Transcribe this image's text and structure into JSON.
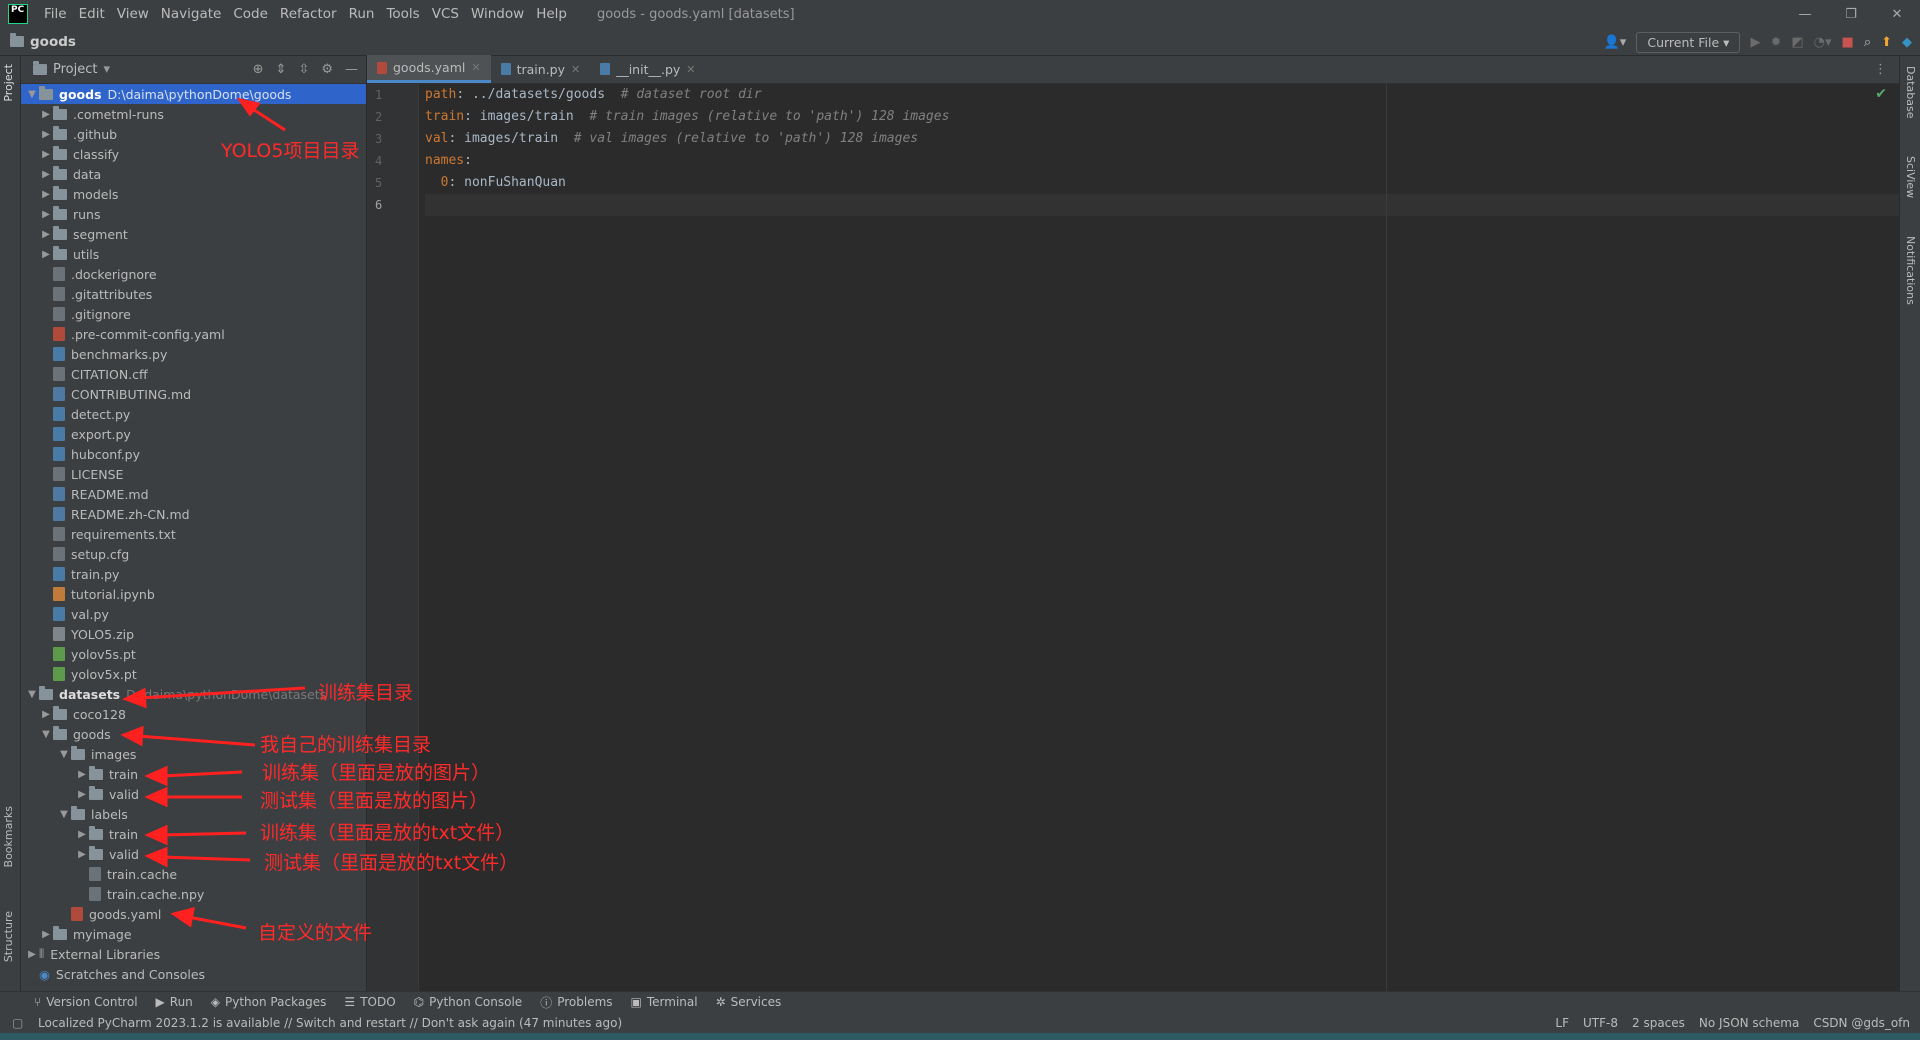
{
  "titlebar": {
    "menu": [
      "File",
      "Edit",
      "View",
      "Navigate",
      "Code",
      "Refactor",
      "Run",
      "Tools",
      "VCS",
      "Window",
      "Help"
    ],
    "title": "goods - goods.yaml [datasets]"
  },
  "navbar": {
    "crumb": "goods",
    "run_config": "Current File"
  },
  "left_strip": {
    "project": "Project",
    "bookmarks": "Bookmarks",
    "structure": "Structure"
  },
  "right_strip": {
    "database": "Database",
    "sciview": "SciView",
    "notifications": "Notifications"
  },
  "project_panel": {
    "title": "Project",
    "root": {
      "name": "goods",
      "path": "D:\\daima\\pythonDome\\goods"
    },
    "items": [
      {
        "label": ".cometml-runs"
      },
      {
        "label": ".github"
      },
      {
        "label": "classify"
      },
      {
        "label": "data"
      },
      {
        "label": "models"
      },
      {
        "label": "runs"
      },
      {
        "label": "segment"
      },
      {
        "label": "utils"
      },
      {
        "label": ".dockerignore"
      },
      {
        "label": ".gitattributes"
      },
      {
        "label": ".gitignore"
      },
      {
        "label": ".pre-commit-config.yaml"
      },
      {
        "label": "benchmarks.py"
      },
      {
        "label": "CITATION.cff"
      },
      {
        "label": "CONTRIBUTING.md"
      },
      {
        "label": "detect.py"
      },
      {
        "label": "export.py"
      },
      {
        "label": "hubconf.py"
      },
      {
        "label": "LICENSE"
      },
      {
        "label": "README.md"
      },
      {
        "label": "README.zh-CN.md"
      },
      {
        "label": "requirements.txt"
      },
      {
        "label": "setup.cfg"
      },
      {
        "label": "train.py"
      },
      {
        "label": "tutorial.ipynb"
      },
      {
        "label": "val.py"
      },
      {
        "label": "YOLO5.zip"
      },
      {
        "label": "yolov5s.pt"
      },
      {
        "label": "yolov5x.pt"
      }
    ],
    "datasets": {
      "name": "datasets",
      "path": "D:\\daima\\pythonDome\\datasets"
    },
    "ds_items": [
      "coco128",
      "goods",
      "images",
      "train",
      "valid",
      "labels",
      "train",
      "valid",
      "train.cache",
      "train.cache.npy",
      "goods.yaml",
      "myimage"
    ],
    "external": "External Libraries",
    "scratches": "Scratches and Consoles"
  },
  "editor": {
    "tabs": [
      "goods.yaml",
      "train.py",
      "__init__.py"
    ],
    "line_numbers": [
      "1",
      "2",
      "3",
      "4",
      "5",
      "6"
    ],
    "lines": [
      {
        "key": "path",
        "val": ": ../datasets/goods  ",
        "comment": "# dataset root dir"
      },
      {
        "key": "train",
        "val": ": images/train  ",
        "comment": "# train images (relative to 'path') 128 images"
      },
      {
        "key": "val",
        "val": ": images/train  ",
        "comment": "# val images (relative to 'path') 128 images"
      },
      {
        "key": "names",
        "val": ":",
        "comment": ""
      },
      {
        "key": "  0",
        "val": ": nonFuShanQuan",
        "comment": ""
      }
    ]
  },
  "annotations": {
    "yolo": "YOLO5项目目录",
    "train_dir": "训练集目录",
    "my_train_dir": "我自己的训练集目录",
    "img_train": "训练集（里面是放的图片）",
    "img_valid": "测试集（里面是放的图片）",
    "lbl_train": "训练集（里面是放的txt文件）",
    "lbl_valid": "测试集（里面是放的txt文件）",
    "custom_file": "自定义的文件"
  },
  "toolwindows": [
    "Version Control",
    "Run",
    "Python Packages",
    "TODO",
    "Python Console",
    "Problems",
    "Terminal",
    "Services"
  ],
  "status": {
    "message": "Localized PyCharm 2023.1.2 is available // Switch and restart // Don't ask again (47 minutes ago)",
    "right": [
      "LF",
      "UTF-8",
      "2 spaces",
      "No JSON schema",
      "CSDN @gds_ofn"
    ]
  }
}
